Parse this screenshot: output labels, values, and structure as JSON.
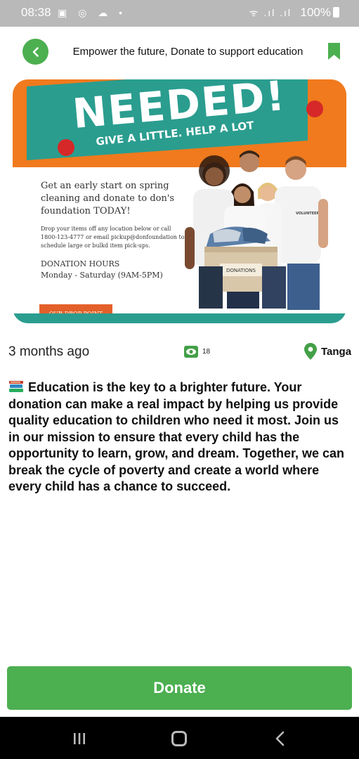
{
  "status_bar": {
    "time": "08:38",
    "left_icons": "▣ ◎ ☁ •",
    "signal": "ᯤ .ıl .ıl",
    "battery": "100%"
  },
  "header": {
    "title": "Empower the future, Donate to support education",
    "back_icon": "chevron-left-icon",
    "bookmark_icon": "bookmark-icon",
    "accent_color": "#4caf50"
  },
  "banner": {
    "headline": "NEEDED!",
    "tagline": "GIVE A LITTLE. HELP A LOT",
    "lead": "Get an early start on spring cleaning and donate to don's foundation TODAY!",
    "small": "Drop your items off any location below or call 1800-123-4777 or email pickup@donfoundation to schedule large or bulkd item pick-ups.",
    "hours_label": "DONATION HOURS",
    "hours": "Monday - Saturday (9AM-5PM)",
    "drop_point": "OUR DROP POINT",
    "box_label": "DONATIONS",
    "shirt_label": "VOLUNTEER"
  },
  "post": {
    "time_ago": "3 months ago",
    "views": "18",
    "location": "Tanga",
    "description": "Education is the key to a brighter future. Your donation can make a real impact by helping us provide quality education to children who need it most. Join us in our mission to ensure that every child has the opportunity to learn, grow, and dream. Together, we can break the cycle of poverty and create a world where every child has a chance to succeed."
  },
  "donate_button": {
    "label": "Donate"
  },
  "navbar": {
    "recent_icon": "recent-apps-icon",
    "home_icon": "home-icon",
    "back_icon": "back-icon"
  }
}
